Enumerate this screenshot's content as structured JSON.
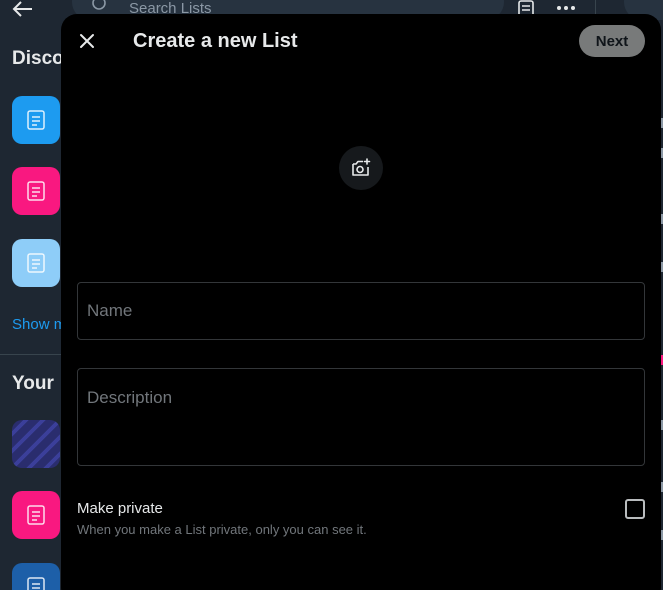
{
  "background": {
    "search_placeholder": "Search Lists",
    "discover_heading": "Disco",
    "show_more": "Show m",
    "your_lists_heading": "Your",
    "tiles_discover": [
      "#1d9bf0",
      "#f91880",
      "#8ecdf8"
    ],
    "tiles_yours": [
      "#2a2d6e",
      "#f91880",
      "#1d5fa8"
    ]
  },
  "modal": {
    "title": "Create a new List",
    "next_label": "Next",
    "name_placeholder": "Name",
    "description_placeholder": "Description",
    "make_private_label": "Make private",
    "make_private_help": "When you make a List private, only you can see it."
  },
  "colors": {
    "accent": "#1d9bf0",
    "modal_bg": "#000000",
    "next_button_bg": "#787a7a"
  },
  "icons": {
    "close": "close-icon",
    "add_photo": "add-photo-icon",
    "back": "arrow-left-icon",
    "search": "search-icon",
    "new_list": "new-list-icon",
    "more": "more-icon"
  }
}
